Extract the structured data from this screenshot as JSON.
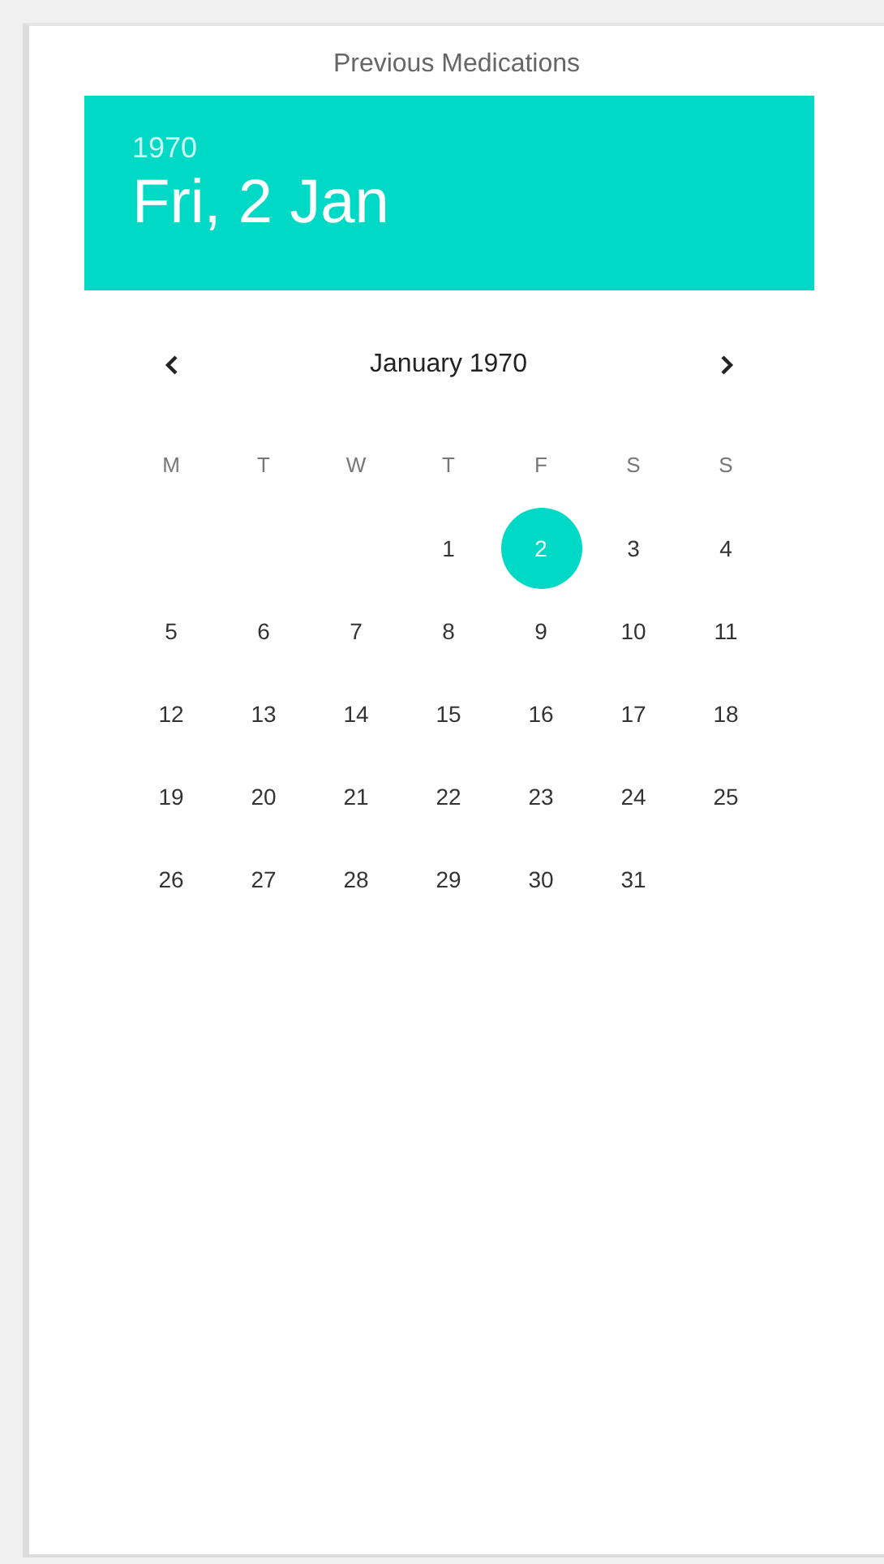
{
  "title": "Previous Medications",
  "header": {
    "year": "1970",
    "date": "Fri, 2 Jan"
  },
  "calendar": {
    "month": "January 1970",
    "weekdays": [
      "M",
      "T",
      "W",
      "T",
      "F",
      "S",
      "S"
    ],
    "weeks": [
      [
        {
          "kind": "blank"
        },
        {
          "kind": "blank"
        },
        {
          "kind": "blank"
        },
        {
          "kind": "day",
          "label": "1",
          "selected": false
        },
        {
          "kind": "day",
          "label": "2",
          "selected": true
        },
        {
          "kind": "day",
          "label": "3",
          "selected": false
        },
        {
          "kind": "day",
          "label": "4",
          "selected": false
        }
      ],
      [
        {
          "kind": "day",
          "label": "5",
          "selected": false
        },
        {
          "kind": "day",
          "label": "6",
          "selected": false
        },
        {
          "kind": "day",
          "label": "7",
          "selected": false
        },
        {
          "kind": "day",
          "label": "8",
          "selected": false
        },
        {
          "kind": "day",
          "label": "9",
          "selected": false
        },
        {
          "kind": "day",
          "label": "10",
          "selected": false
        },
        {
          "kind": "day",
          "label": "11",
          "selected": false
        }
      ],
      [
        {
          "kind": "day",
          "label": "12",
          "selected": false
        },
        {
          "kind": "day",
          "label": "13",
          "selected": false
        },
        {
          "kind": "day",
          "label": "14",
          "selected": false
        },
        {
          "kind": "day",
          "label": "15",
          "selected": false
        },
        {
          "kind": "day",
          "label": "16",
          "selected": false
        },
        {
          "kind": "day",
          "label": "17",
          "selected": false
        },
        {
          "kind": "day",
          "label": "18",
          "selected": false
        }
      ],
      [
        {
          "kind": "day",
          "label": "19",
          "selected": false
        },
        {
          "kind": "day",
          "label": "20",
          "selected": false
        },
        {
          "kind": "day",
          "label": "21",
          "selected": false
        },
        {
          "kind": "day",
          "label": "22",
          "selected": false
        },
        {
          "kind": "day",
          "label": "23",
          "selected": false
        },
        {
          "kind": "day",
          "label": "24",
          "selected": false
        },
        {
          "kind": "day",
          "label": "25",
          "selected": false
        }
      ],
      [
        {
          "kind": "day",
          "label": "26",
          "selected": false
        },
        {
          "kind": "day",
          "label": "27",
          "selected": false
        },
        {
          "kind": "day",
          "label": "28",
          "selected": false
        },
        {
          "kind": "day",
          "label": "29",
          "selected": false
        },
        {
          "kind": "day",
          "label": "30",
          "selected": false
        },
        {
          "kind": "day",
          "label": "31",
          "selected": false
        },
        {
          "kind": "blank"
        }
      ]
    ]
  }
}
